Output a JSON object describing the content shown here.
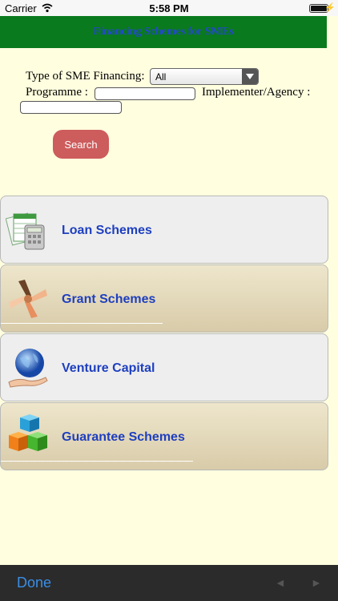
{
  "status_bar": {
    "carrier": "Carrier",
    "time": "5:58 PM",
    "battery_level": 1.0
  },
  "header": {
    "title": "Financing Schemes for SMEs"
  },
  "form": {
    "type_label": "Type of SME Financing:",
    "type_value": "All",
    "programme_label": "Programme :",
    "programme_value": "",
    "implementer_label": "Implementer/Agency :",
    "implementer_value": "",
    "search_label": "Search"
  },
  "schemes": [
    {
      "label": "Loan Schemes",
      "icon": "calculator-spreadsheet-icon"
    },
    {
      "label": "Grant Schemes",
      "icon": "joined-hands-icon"
    },
    {
      "label": "Venture Capital",
      "icon": "globe-in-hand-icon"
    },
    {
      "label": "Guarantee Schemes",
      "icon": "stacked-cubes-icon"
    }
  ],
  "toolbar": {
    "done_label": "Done",
    "back_glyph": "◄",
    "forward_glyph": "►"
  },
  "colors": {
    "header_bg": "#0a7a1e",
    "header_text": "#2148c9",
    "page_bg": "#fffedf",
    "search_button": "#cd5c5c",
    "scheme_label": "#1e3fbf",
    "toolbar_bg": "#2b2b2b",
    "done_text": "#3a8ee6"
  }
}
